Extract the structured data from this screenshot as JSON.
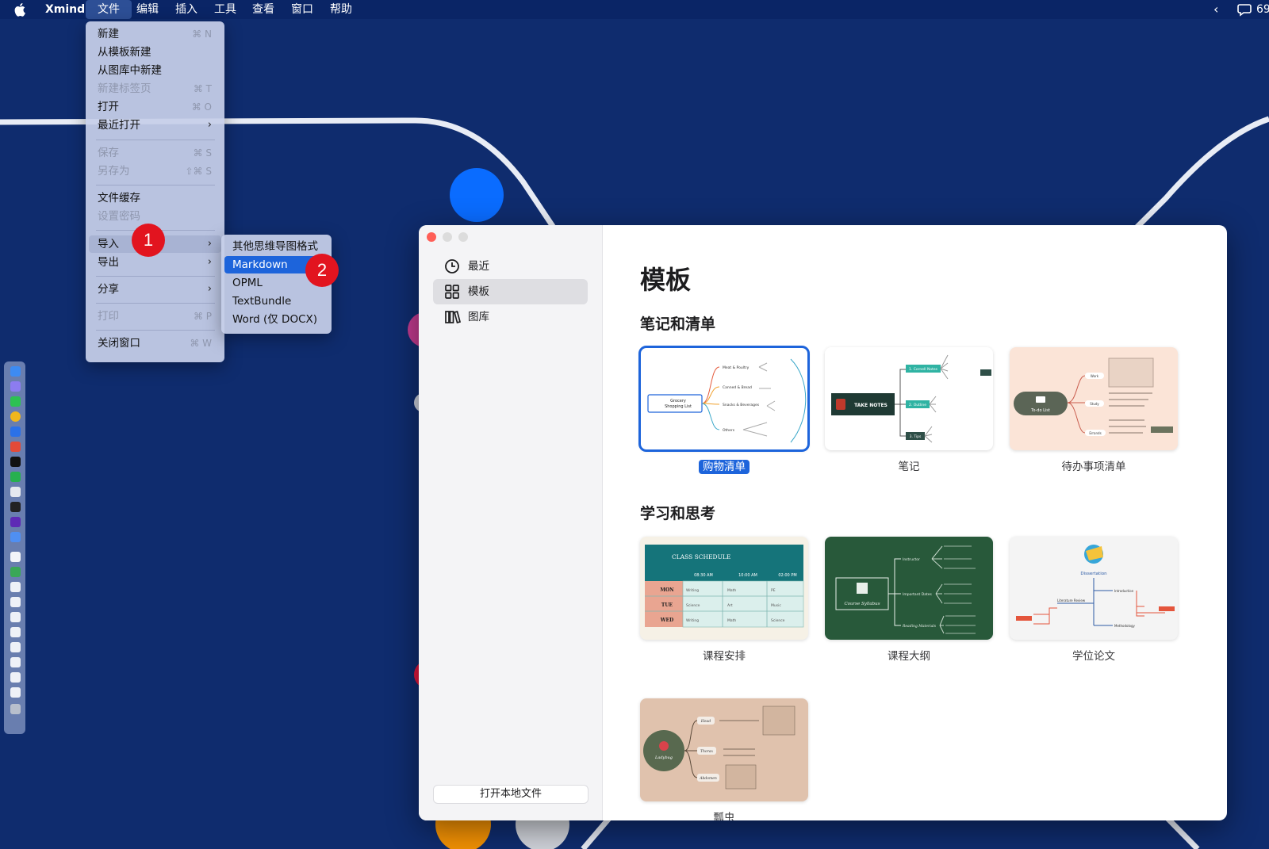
{
  "menubar": {
    "app_name": "Xmind",
    "menus": [
      "文件",
      "编辑",
      "插入",
      "工具",
      "查看",
      "窗口",
      "帮助"
    ],
    "right_chevron": "‹",
    "right_text": "69"
  },
  "file_menu": {
    "items": [
      {
        "label": "新建",
        "shortcut": "⌘ N",
        "disabled": false
      },
      {
        "label": "从模板新建",
        "shortcut": "",
        "disabled": false
      },
      {
        "label": "从图库中新建",
        "shortcut": "",
        "disabled": false
      },
      {
        "label": "新建标签页",
        "shortcut": "⌘ T",
        "disabled": true
      },
      {
        "label": "打开",
        "shortcut": "⌘ O",
        "disabled": false
      },
      {
        "label": "最近打开",
        "shortcut": "",
        "submenu": true,
        "disabled": false
      },
      {
        "label": "保存",
        "shortcut": "⌘ S",
        "disabled": true
      },
      {
        "label": "另存为",
        "shortcut": "⇧⌘ S",
        "disabled": true
      },
      {
        "label": "文件缓存",
        "shortcut": "",
        "disabled": false
      },
      {
        "label": "设置密码",
        "shortcut": "",
        "disabled": true
      },
      {
        "label": "导入",
        "shortcut": "",
        "submenu": true,
        "highlighted": true,
        "disabled": false
      },
      {
        "label": "导出",
        "shortcut": "",
        "submenu": true,
        "disabled": false
      },
      {
        "label": "分享",
        "shortcut": "",
        "submenu": true,
        "disabled": false
      },
      {
        "label": "打印",
        "shortcut": "⌘ P",
        "disabled": true
      },
      {
        "label": "关闭窗口",
        "shortcut": "⌘ W",
        "disabled": false
      }
    ]
  },
  "import_submenu": {
    "items": [
      "其他思维导图格式",
      "Markdown",
      "OPML",
      "TextBundle",
      "Word (仅 DOCX)"
    ],
    "selected": "Markdown"
  },
  "step_badges": [
    "1",
    "2"
  ],
  "window": {
    "sidebar": {
      "nav": [
        {
          "label": "最近",
          "icon": "clock-icon"
        },
        {
          "label": "模板",
          "icon": "grid-icon",
          "selected": true
        },
        {
          "label": "图库",
          "icon": "library-icon"
        }
      ],
      "open_local": "打开本地文件"
    },
    "title": "模板",
    "sections": [
      {
        "title": "笔记和清单",
        "templates": [
          "购物清单",
          "笔记",
          "待办事项清单"
        ]
      },
      {
        "title": "学习和思考",
        "templates": [
          "课程安排",
          "课程大纲",
          "学位论文",
          "瓢虫"
        ]
      }
    ],
    "selected_template": "购物清单"
  },
  "thumbnails": {
    "shopping": {
      "center": "Grocery Shopping List",
      "branches": [
        "Meat & Poultry",
        "Canned & Bread",
        "Snacks & Beverages",
        "Others"
      ]
    },
    "notes": {
      "center": "TAKE NOTES",
      "branches": [
        "1. Cornell Notes",
        "2. Outline",
        "3. Tips"
      ]
    },
    "todo": {
      "center": "To-do List",
      "branches": [
        "Work",
        "Study",
        "Errands"
      ]
    },
    "schedule": {
      "title": "CLASS SCHEDULE",
      "times": [
        "08:30 AM",
        "10:00 AM",
        "02:00 PM"
      ],
      "days": [
        "MON",
        "TUE",
        "WED"
      ],
      "cells": [
        [
          "Writing",
          "Math",
          "PE"
        ],
        [
          "Science",
          "Art",
          "Music"
        ],
        [
          "Writing",
          "Math",
          "Science"
        ]
      ]
    },
    "syllabus": {
      "center": "Course Syllabus",
      "branches": [
        "Instructor",
        "Important Dates",
        "Reading Materials"
      ]
    },
    "dissertation": {
      "center": "Dissertation",
      "branches": [
        "Introduction",
        "Literature Review",
        "Methodology"
      ]
    },
    "ladybug": {
      "center": "Ladybug",
      "branches": [
        "Head",
        "Thorax",
        "Abdomen"
      ]
    }
  },
  "colors": {
    "desktop": "#0f2c6e",
    "accent": "#1d64db",
    "badge": "#e2141f"
  }
}
